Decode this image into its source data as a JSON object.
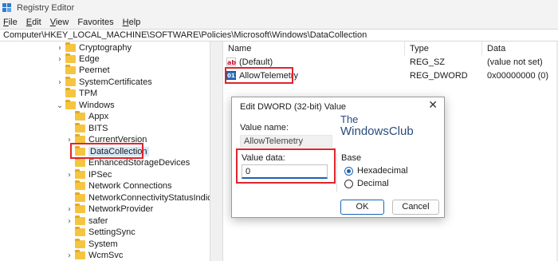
{
  "window": {
    "title": "Registry Editor"
  },
  "menu": [
    {
      "label": "File",
      "key": "F",
      "rest": "ile"
    },
    {
      "label": "Edit",
      "key": "E",
      "rest": "dit"
    },
    {
      "label": "View",
      "key": "V",
      "rest": "iew"
    },
    {
      "label": "Favorites",
      "key": "",
      "rest": "Favorites"
    },
    {
      "label": "Help",
      "key": "H",
      "rest": "elp"
    }
  ],
  "address": "Computer\\HKEY_LOCAL_MACHINE\\SOFTWARE\\Policies\\Microsoft\\Windows\\DataCollection",
  "tree": {
    "items": [
      {
        "label": "Cryptography",
        "chevron": ">"
      },
      {
        "label": "Edge",
        "chevron": ">"
      },
      {
        "label": "Peernet",
        "chevron": ""
      },
      {
        "label": "SystemCertificates",
        "chevron": ">"
      },
      {
        "label": "TPM",
        "chevron": ""
      },
      {
        "label": "Windows",
        "chevron": "v"
      },
      {
        "label": "Appx",
        "chevron": ""
      },
      {
        "label": "BITS",
        "chevron": ""
      },
      {
        "label": "CurrentVersion",
        "chevron": ">"
      },
      {
        "label": "DataCollection",
        "chevron": ""
      },
      {
        "label": "EnhancedStorageDevices",
        "chevron": ""
      },
      {
        "label": "IPSec",
        "chevron": ">"
      },
      {
        "label": "Network Connections",
        "chevron": ""
      },
      {
        "label": "NetworkConnectivityStatusIndicato",
        "chevron": ""
      },
      {
        "label": "NetworkProvider",
        "chevron": ">"
      },
      {
        "label": "safer",
        "chevron": ">"
      },
      {
        "label": "SettingSync",
        "chevron": ""
      },
      {
        "label": "System",
        "chevron": ""
      },
      {
        "label": "WcmSvc",
        "chevron": ">"
      }
    ]
  },
  "list": {
    "headers": {
      "name": "Name",
      "type": "Type",
      "data": "Data"
    },
    "rows": [
      {
        "name": "(Default)",
        "type": "REG_SZ",
        "data": "(value not set)",
        "icon": "ab"
      },
      {
        "name": "AllowTelemetry",
        "type": "REG_DWORD",
        "data": "0x00000000 (0)",
        "icon": "011"
      }
    ]
  },
  "dialog": {
    "title": "Edit DWORD (32-bit) Value",
    "close_glyph": "✕",
    "value_name_label": "Value name:",
    "value_name": "AllowTelemetry",
    "value_data_label": "Value data:",
    "value_data": "0",
    "base_label": "Base",
    "base_options": [
      {
        "label": "Hexadecimal",
        "selected": true
      },
      {
        "label": "Decimal",
        "selected": false
      }
    ],
    "ok_label": "OK",
    "cancel_label": "Cancel"
  },
  "watermark": {
    "line1": "The",
    "line2": "WindowsClub"
  },
  "colors": {
    "highlight": "#e0242c",
    "accent": "#1a64b4",
    "folder": "#f5c542"
  }
}
